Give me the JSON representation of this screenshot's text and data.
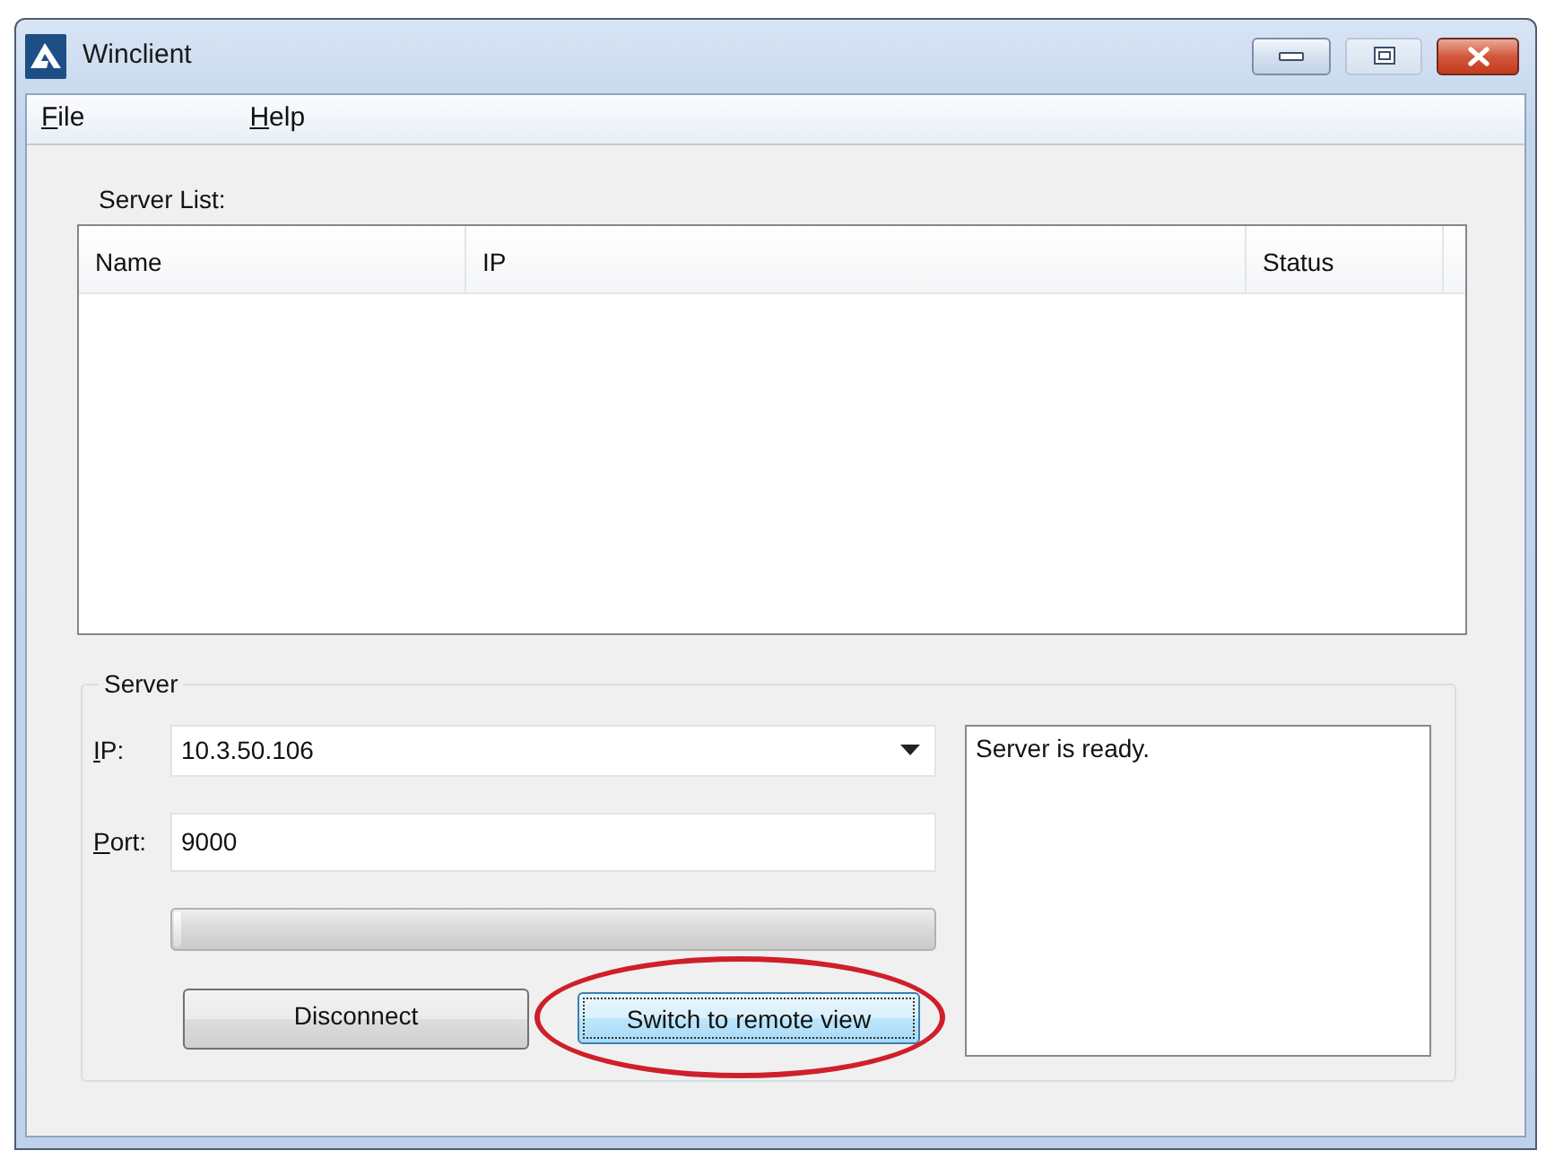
{
  "window": {
    "title": "Winclient"
  },
  "menu": [
    {
      "label": "File",
      "mnemonic": true
    },
    {
      "label": "Help",
      "mnemonic": true
    }
  ],
  "server_list": {
    "label": "Server List:",
    "columns": [
      "Name",
      "IP",
      "Status"
    ]
  },
  "server": {
    "legend": "Server",
    "fields": [
      {
        "kind": "dropdown",
        "label": "IP:",
        "mnemonic": true,
        "value": "10.3.50.106"
      },
      {
        "kind": "text",
        "label": "Port:",
        "mnemonic": true,
        "value": "9000"
      }
    ],
    "progress": {
      "level": 0.01
    },
    "buttons": [
      {
        "label": "Disconnect",
        "focused": false,
        "highlighted": false
      },
      {
        "label": "Switch to remote view",
        "focused": true,
        "highlighted": true
      }
    ],
    "log": "Server is ready."
  }
}
